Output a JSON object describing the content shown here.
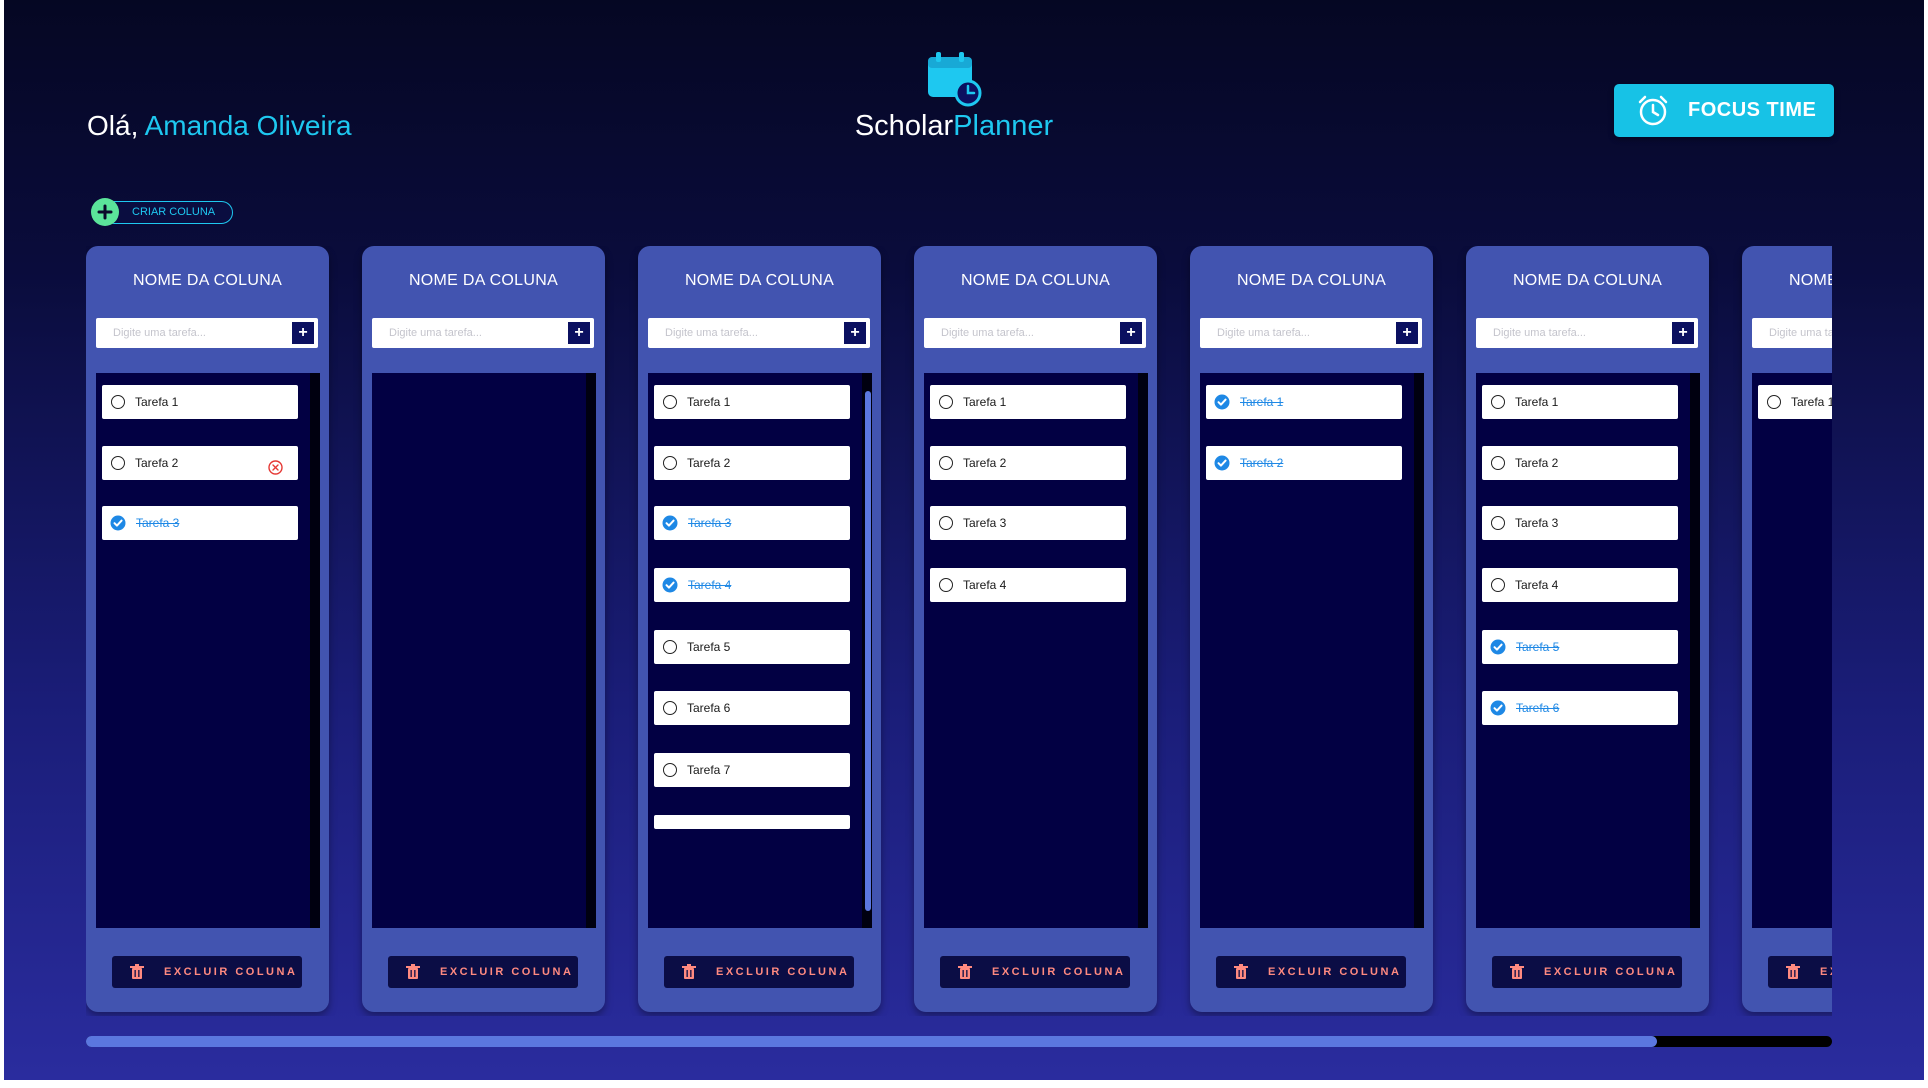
{
  "header": {
    "greeting_prefix": "Olá, ",
    "user_name": "Amanda Oliveira",
    "brand_part1": "Scholar",
    "brand_part2": "Planner",
    "logo_icon": "calendar-clock-icon",
    "focus_label": "FOCUS TIME",
    "focus_icon": "alarm-clock-icon"
  },
  "create_column": {
    "label": "CRIAR COLUNA",
    "icon": "plus-circle-icon"
  },
  "colors": {
    "accent": "#1ec8f0",
    "panel": "#4254b0",
    "list_bg": "#020043",
    "done": "#1e88e5",
    "delete_text": "#ff8a80",
    "add_green": "#5be49a"
  },
  "columns": [
    {
      "title": "NOME DA COLUNA",
      "placeholder": "Digite uma tarefa...",
      "delete_label": "EXCLUIR COLUNA",
      "tasks": [
        {
          "label": "Tarefa 1",
          "done": false
        },
        {
          "label": "Tarefa 2",
          "done": false,
          "remove_visible": true
        },
        {
          "label": "Tarefa 3",
          "done": true
        }
      ]
    },
    {
      "title": "NOME DA COLUNA",
      "placeholder": "Digite uma tarefa...",
      "delete_label": "EXCLUIR COLUNA",
      "tasks": []
    },
    {
      "title": "NOME DA COLUNA",
      "placeholder": "Digite uma tarefa...",
      "delete_label": "EXCLUIR COLUNA",
      "scrollbar": true,
      "tasks": [
        {
          "label": "Tarefa 1",
          "done": false
        },
        {
          "label": "Tarefa 2",
          "done": false
        },
        {
          "label": "Tarefa 3",
          "done": true
        },
        {
          "label": "Tarefa 4",
          "done": true
        },
        {
          "label": "Tarefa 5",
          "done": false
        },
        {
          "label": "Tarefa 6",
          "done": false
        },
        {
          "label": "Tarefa 7",
          "done": false
        },
        {
          "label": "",
          "done": false,
          "partial": true
        }
      ]
    },
    {
      "title": "NOME DA COLUNA",
      "placeholder": "Digite uma tarefa...",
      "delete_label": "EXCLUIR COLUNA",
      "tasks": [
        {
          "label": "Tarefa 1",
          "done": false
        },
        {
          "label": "Tarefa 2",
          "done": false
        },
        {
          "label": "Tarefa 3",
          "done": false
        },
        {
          "label": "Tarefa 4",
          "done": false
        }
      ]
    },
    {
      "title": "NOME DA COLUNA",
      "placeholder": "Digite uma tarefa...",
      "delete_label": "EXCLUIR COLUNA",
      "tasks": [
        {
          "label": "Tarefa 1",
          "done": true
        },
        {
          "label": "Tarefa 2",
          "done": true
        }
      ]
    },
    {
      "title": "NOME DA COLUNA",
      "placeholder": "Digite uma tarefa...",
      "delete_label": "EXCLUIR COLUNA",
      "tasks": [
        {
          "label": "Tarefa 1",
          "done": false
        },
        {
          "label": "Tarefa 2",
          "done": false
        },
        {
          "label": "Tarefa 3",
          "done": false
        },
        {
          "label": "Tarefa 4",
          "done": false
        },
        {
          "label": "Tarefa 5",
          "done": true
        },
        {
          "label": "Tarefa 6",
          "done": true
        }
      ]
    },
    {
      "title": "NOME DA COLUNA",
      "placeholder": "Digite uma tarefa...",
      "delete_label": "EXCLUIR COLUNA",
      "tasks": [
        {
          "label": "Tarefa 1",
          "done": false
        }
      ]
    }
  ],
  "board_scroll": {
    "visible_fraction": 0.9
  }
}
